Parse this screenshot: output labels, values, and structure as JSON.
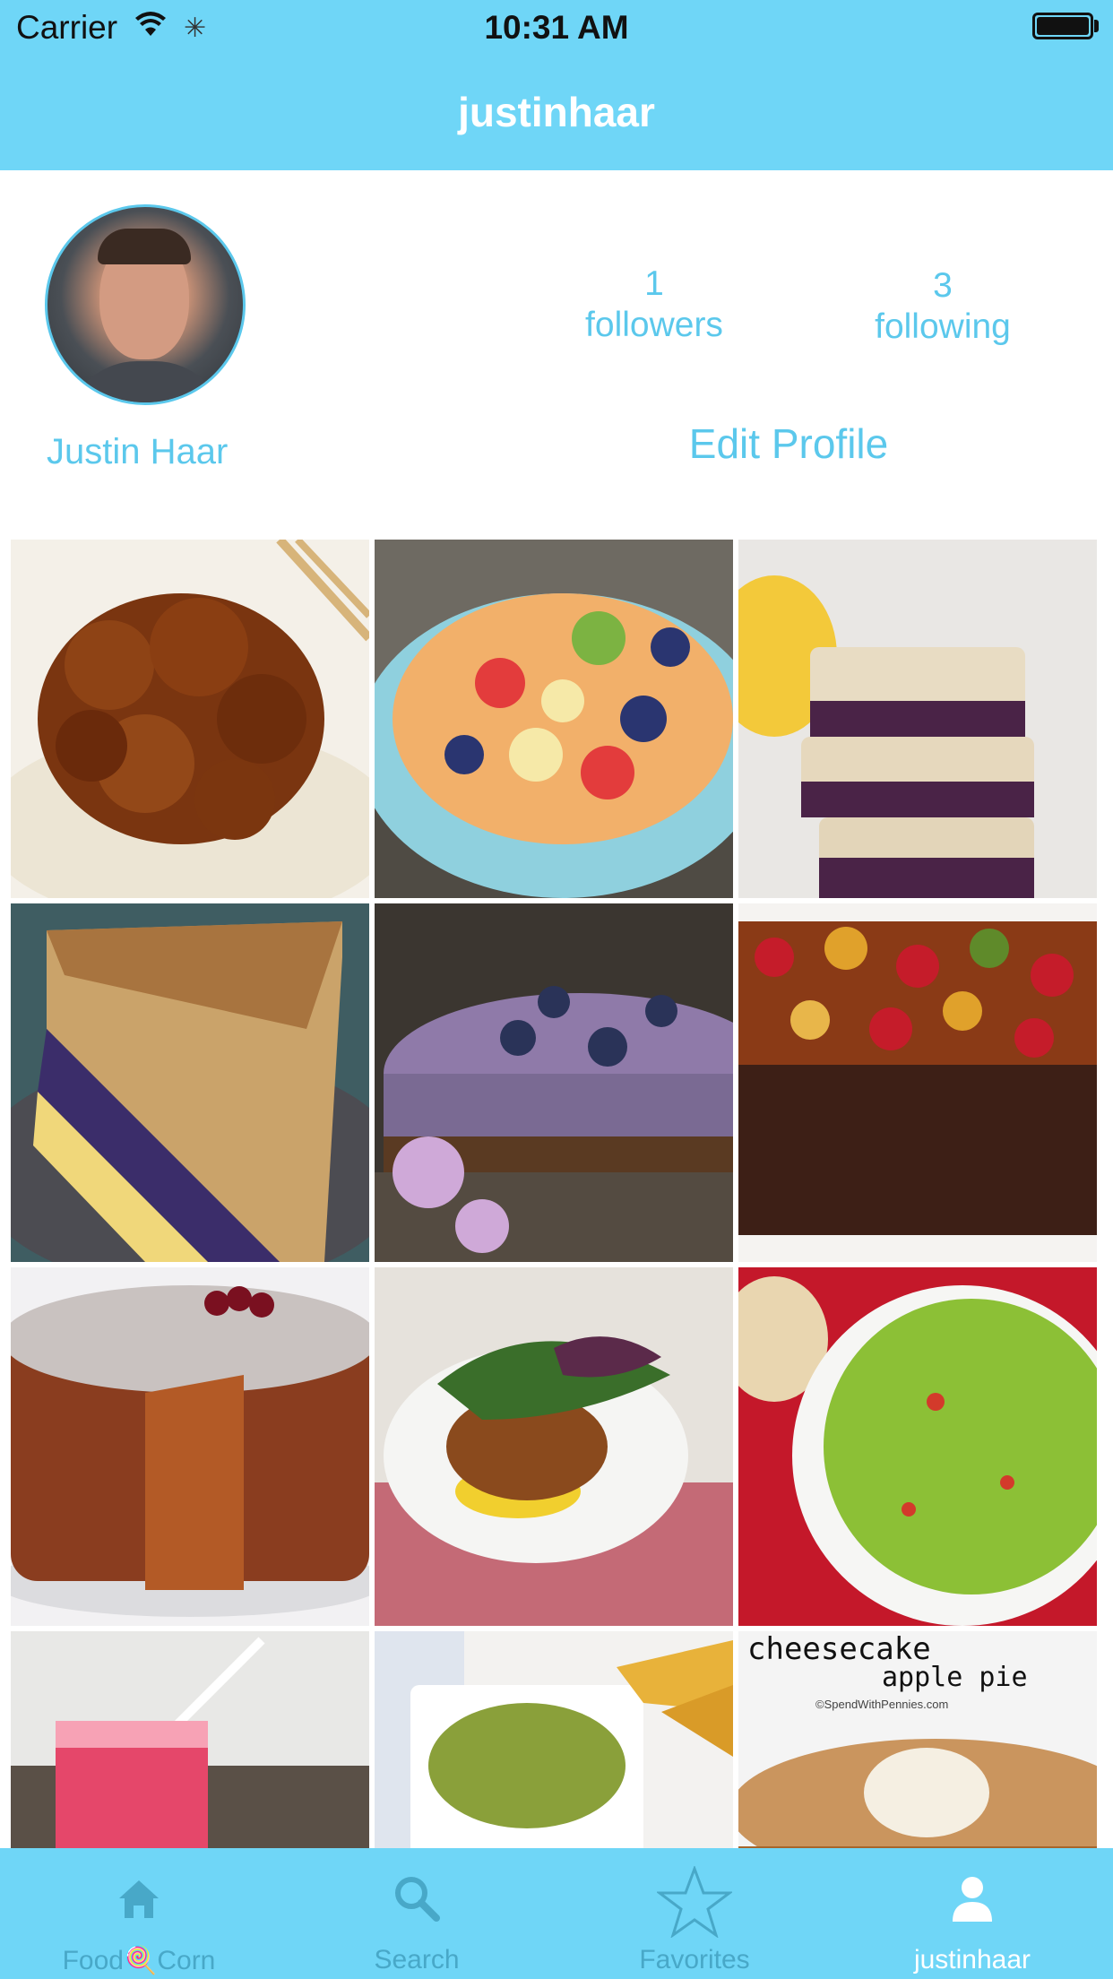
{
  "status_bar": {
    "carrier": "Carrier",
    "time": "10:31 AM"
  },
  "header": {
    "title": "justinhaar"
  },
  "profile": {
    "display_name": "Justin Haar",
    "followers_count": "1",
    "followers_label": "followers",
    "following_count": "3",
    "following_label": "following",
    "edit_label": "Edit Profile"
  },
  "grid": {
    "tile_texts": {
      "cheesecake_title": "cheesecake",
      "cheesecake_sub": "apple pie",
      "cheesecake_credit": "©SpendWithPennies.com"
    }
  },
  "tabbar": {
    "tabs": [
      {
        "label": "Food🍭Corn",
        "icon": "home-icon"
      },
      {
        "label": "Search",
        "icon": "search-icon"
      },
      {
        "label": "Favorites",
        "icon": "star-icon"
      },
      {
        "label": "justinhaar",
        "icon": "person-icon"
      }
    ],
    "active": "justinhaar"
  },
  "colors": {
    "accent": "#6fd6f7",
    "link": "#5bc8ec",
    "tab_inactive": "#48a8c8"
  }
}
